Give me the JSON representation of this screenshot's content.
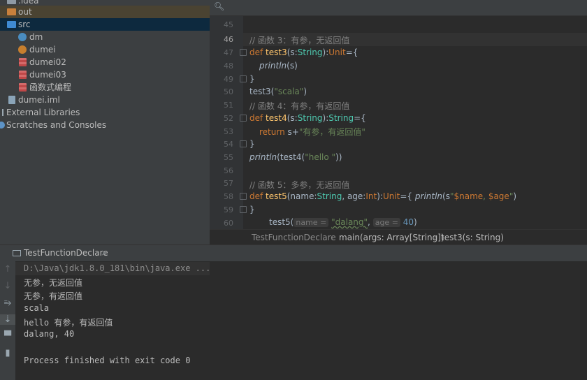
{
  "project_tree": {
    "items": [
      {
        "label": ".idea",
        "icon": "folder-grey-icon"
      },
      {
        "label": "out",
        "icon": "folder-orange-icon"
      },
      {
        "label": "src",
        "icon": "folder-blue-icon"
      },
      {
        "label": "dm",
        "icon": "scala-class-icon"
      },
      {
        "label": "dumei",
        "icon": "scala-object-icon"
      },
      {
        "label": "dumei02",
        "icon": "scala-script-icon"
      },
      {
        "label": "dumei03",
        "icon": "scala-script-icon"
      },
      {
        "label": "函数式编程",
        "icon": "scala-script-icon"
      },
      {
        "label": "dumei.iml",
        "icon": "iml-file-icon"
      },
      {
        "label": "External Libraries",
        "icon": "library-icon"
      },
      {
        "label": "Scratches and Consoles",
        "icon": "scratches-icon"
      }
    ]
  },
  "editor": {
    "line_numbers": [
      "45",
      "46",
      "47",
      "48",
      "49",
      "50",
      "51",
      "52",
      "53",
      "54",
      "55",
      "56",
      "57",
      "58",
      "59",
      "60"
    ],
    "current_line": "46",
    "code": {
      "l46": "// 函数 3：有参，无返回值",
      "l47_kw": "def ",
      "l47_fn": "test3",
      "l47_a": "(s:",
      "l47_t1": "String",
      "l47_b": "):",
      "l47_t2": "Unit",
      "l47_c": "={",
      "l48_fn": "println",
      "l48_rest": "(s)",
      "l49": "}",
      "l50_a": "test3(",
      "l50_s": "\"scala\"",
      "l50_b": ")",
      "l51": "// 函数 4：有参，有返回值",
      "l52_kw": "def ",
      "l52_fn": "test4",
      "l52_a": "(s:",
      "l52_t1": "String",
      "l52_b": "):",
      "l52_t2": "String",
      "l52_c": "={",
      "l53_kw": "return ",
      "l53_a": "s+",
      "l53_s": "\"有参，有返回值\"",
      "l54": "}",
      "l55_fn": "println",
      "l55_a": "(test4(",
      "l55_s": "\"hello \"",
      "l55_b": "))",
      "l57": "// 函数 5：多参，无返回值",
      "l58_kw": "def ",
      "l58_fn": "test5",
      "l58_a": "(name:",
      "l58_t1": "String",
      "l58_b": ", age:",
      "l58_t2": "Int",
      "l58_c": "):",
      "l58_t3": "Unit",
      "l58_d": "={ ",
      "l58_fn2": "println",
      "l58_e": "(s",
      "l58_s1": "\"",
      "l58_v1": "$name",
      "l58_s2": ", ",
      "l58_v2": "$age",
      "l58_s3": "\"",
      "l58_f": ")",
      "l59": "}",
      "l60_a": "test5(",
      "l60_p1": "name =",
      "l60_s": "\"dalang\"",
      "l60_comma": ",",
      "l60_p2": "age =",
      "l60_n": "40",
      "l60_b": ")"
    },
    "breadcrumb": [
      "TestFunctionDeclare",
      "main(args: Array[String])",
      "test3(s: String)"
    ]
  },
  "run_panel": {
    "tab_label": "TestFunctionDeclare",
    "tab_close": "×",
    "output": [
      "D:\\Java\\jdk1.8.0_181\\bin\\java.exe ...",
      "无参，无返回值",
      "无参，有返回值",
      "scala",
      "hello 有参，有返回值",
      "dalang, 40",
      "",
      "Process finished with exit code 0"
    ]
  }
}
